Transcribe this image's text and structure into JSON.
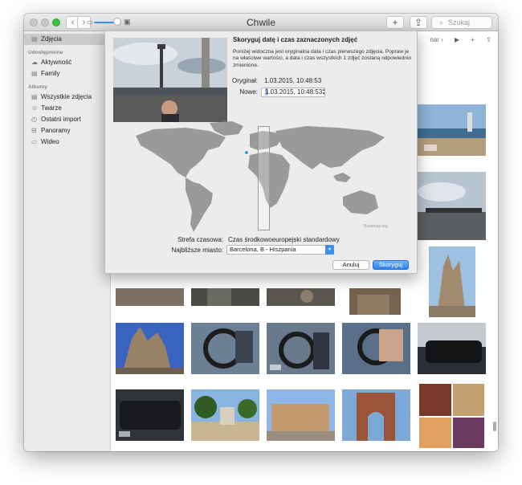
{
  "window": {
    "title": "Chwile",
    "search_placeholder": "Szukaj"
  },
  "toolbar": {
    "back": "‹",
    "forward": "›",
    "add": "+",
    "share": "⇪",
    "right_tools": [
      "nar ›",
      "▶",
      "+",
      "⇪"
    ]
  },
  "sidebar": {
    "selected": "Zdjęcia",
    "sections": [
      {
        "heading": "Udostępnione",
        "items": [
          {
            "label": "Aktywność",
            "icon": "cloud-icon"
          },
          {
            "label": "Family",
            "icon": "album-icon"
          }
        ]
      },
      {
        "heading": "Albumy",
        "items": [
          {
            "label": "Wszystkie zdjęcia",
            "icon": "album-icon"
          },
          {
            "label": "Twarze",
            "icon": "face-icon"
          },
          {
            "label": "Ostatni import",
            "icon": "clock-icon"
          },
          {
            "label": "Panoramy",
            "icon": "panorama-icon"
          },
          {
            "label": "Wideo",
            "icon": "video-icon"
          }
        ]
      }
    ]
  },
  "dialog": {
    "title": "Skoryguj datę i czas zaznaczonych zdjęć",
    "description": "Poniżej widoczna jest oryginalna data i czas pierwszego zdjęcia. Popraw je na właściwe wartości, a data i czas wszystkich 1 zdjęć zostaną odpowiednio zmienione.",
    "original_label": "Oryginał:",
    "original_value": "1.03.2015, 10:48:53",
    "new_label": "Nowe:",
    "new_value_day": "1",
    "new_value_rest": ".03.2015, 10:48:53",
    "timezone_label": "Strefa czasowa:",
    "timezone_value": "Czas środkowoeuropejski standardowy",
    "city_label": "Najbliższe miasto:",
    "city_value": "Barcelona, B - Hiszpania",
    "map_credit": "Basemap.org",
    "cancel": "Anuluj",
    "ok": "Skoryguj"
  },
  "colors": {
    "accent": "#3d8ef0",
    "sidebar_bg": "#ebebeb",
    "dialog_bg": "#ececec",
    "map_land": "#9a9a9a"
  }
}
